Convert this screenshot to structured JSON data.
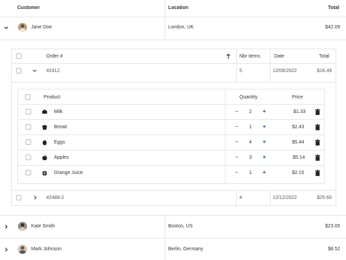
{
  "main_table": {
    "headers": {
      "customer": "Customer",
      "location": "Location",
      "total": "Total"
    },
    "rows": [
      {
        "name": "Jane Doe",
        "location": "London, UK",
        "total": "$42.09",
        "expanded": true
      },
      {
        "name": "Kate Smith",
        "location": "Boston, US",
        "total": "$23.05",
        "expanded": false
      },
      {
        "name": "Mark Johnson",
        "location": "Berlin, Germany",
        "total": "$8.52",
        "expanded": false
      }
    ]
  },
  "orders_table": {
    "headers": {
      "order": "Order #",
      "items": "Nbr items",
      "date": "Date",
      "total": "Total"
    },
    "rows": [
      {
        "order": "#2412",
        "items": "5",
        "date": "12/06/2022",
        "total": "$16.49",
        "expanded": true
      },
      {
        "order": "#2488-2",
        "items": "4",
        "date": "12/12/2022",
        "total": "$25.60",
        "expanded": false
      }
    ]
  },
  "products_table": {
    "headers": {
      "product": "Product",
      "quantity": "Quantity",
      "price": "Price"
    },
    "rows": [
      {
        "icon": "milk-icon",
        "name": "Milk",
        "qty": "2",
        "price": "$1.33"
      },
      {
        "icon": "bread-icon",
        "name": "Bread",
        "qty": "1",
        "price": "$2.43"
      },
      {
        "icon": "egg-icon",
        "name": "Eggs",
        "qty": "4",
        "price": "$5.44"
      },
      {
        "icon": "apple-icon",
        "name": "Apples",
        "qty": "3",
        "price": "$5.14"
      },
      {
        "icon": "orange-juice-icon",
        "name": "Orange Juice",
        "qty": "1",
        "price": "$2.15"
      }
    ],
    "minus_symbol": "−",
    "plus_symbol": "+"
  },
  "colors": {
    "border": "#e6e6e6",
    "plus": "#1a3fa8",
    "text": "#333333"
  }
}
